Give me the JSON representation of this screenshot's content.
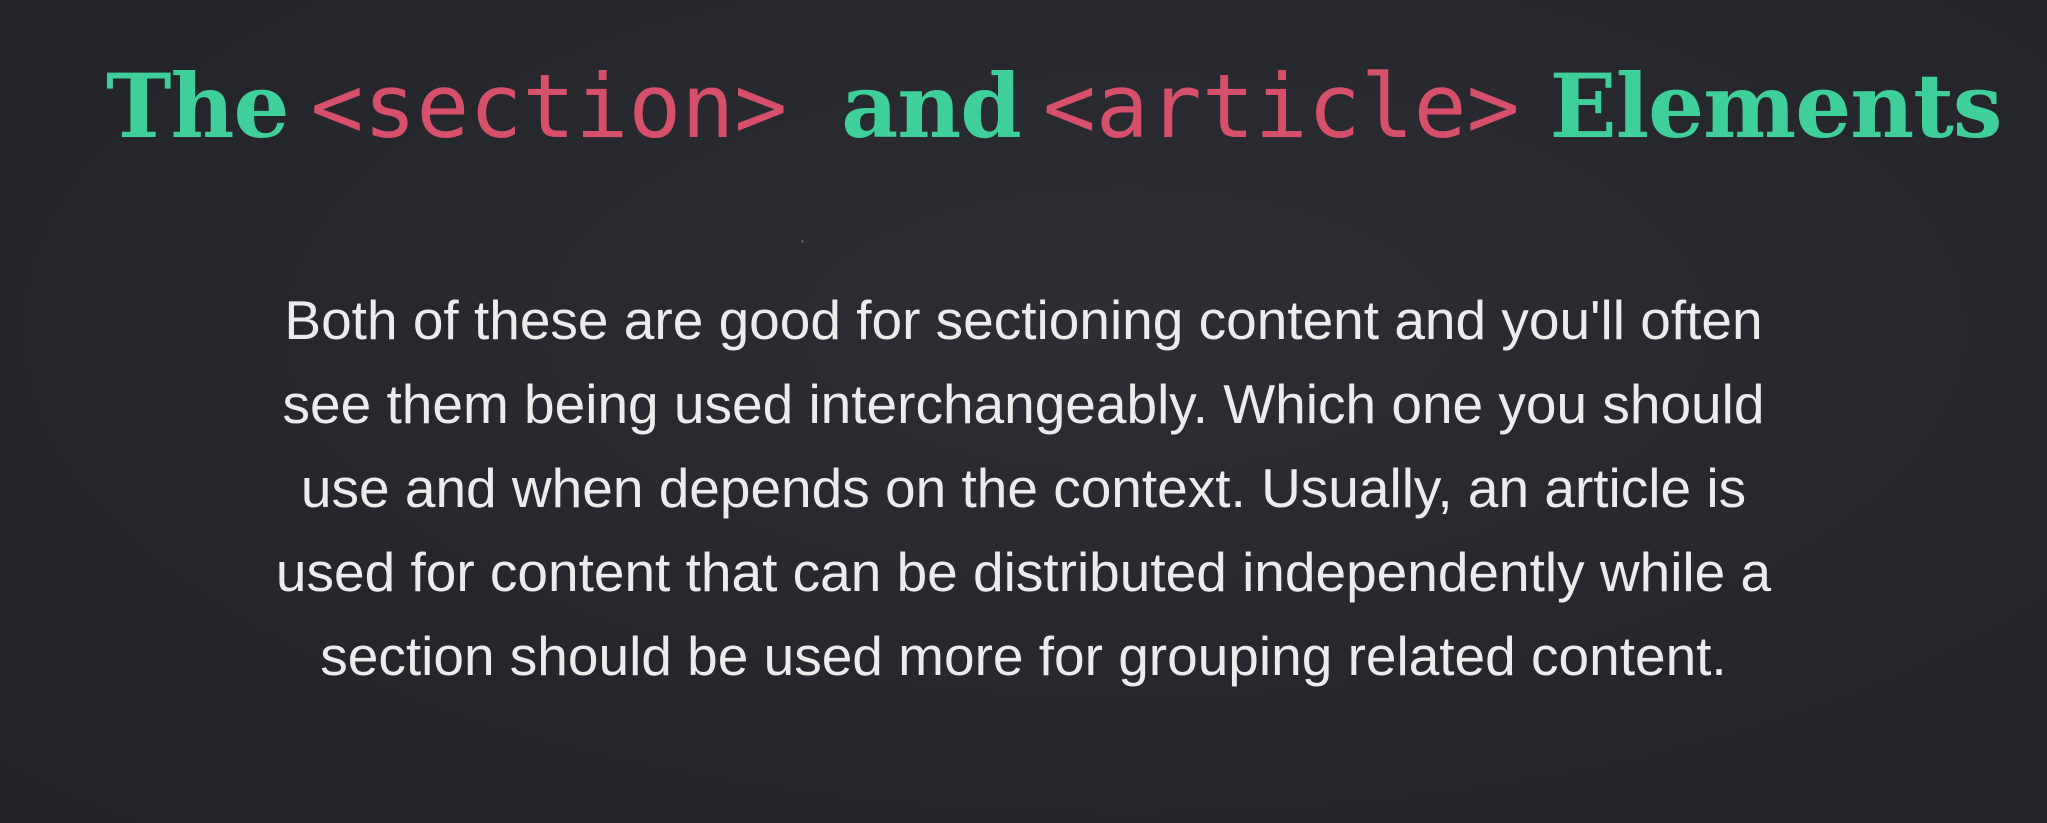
{
  "slide": {
    "title": {
      "word1": "The",
      "tag1": "<section>",
      "word2": "and",
      "tag2": "<article>",
      "word3": "Elements"
    },
    "body": {
      "lines": [
        "Both of these are good for sectioning content and you'll often",
        "see them being used interchangeably. Which one you should",
        "use and when depends on the context. Usually, an article is",
        "used for content that can be distributed independently while a",
        "section should be used more for grouping related content."
      ]
    }
  },
  "colors": {
    "background": "#25272c",
    "title_green": "#3ecf9a",
    "tag_red": "#d6506b",
    "body_text": "#ececec"
  }
}
